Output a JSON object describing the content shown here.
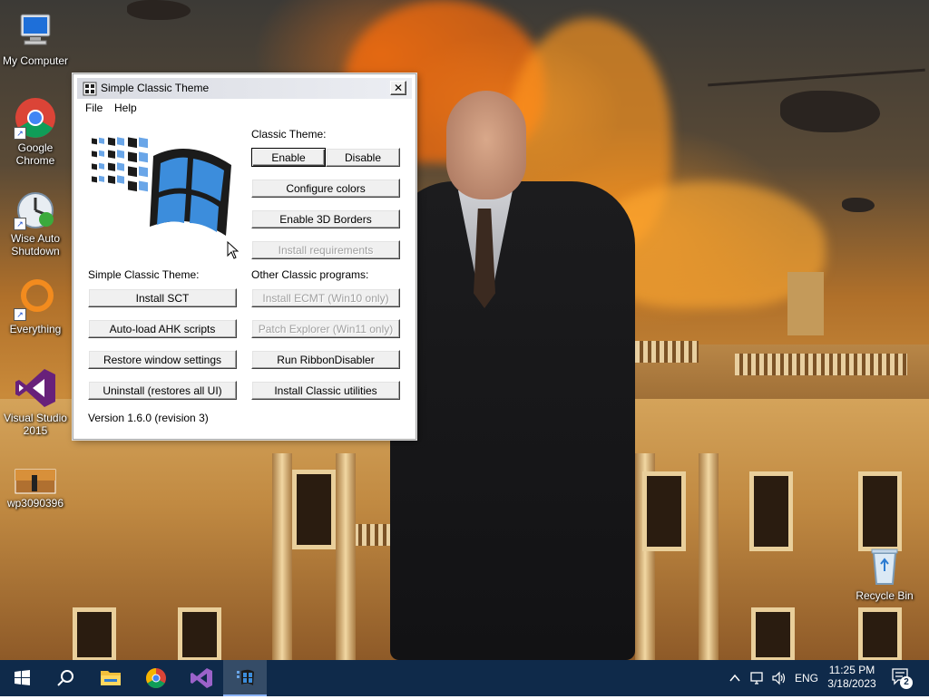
{
  "desktop": {
    "icons": [
      {
        "label": "My Computer",
        "icon": "computer-icon"
      },
      {
        "label": "Google Chrome",
        "icon": "chrome-icon"
      },
      {
        "label": "Wise Auto Shutdown",
        "icon": "wise-auto-shutdown-icon"
      },
      {
        "label": "Everything",
        "icon": "everything-icon"
      },
      {
        "label": "Visual Studio 2015",
        "icon": "visual-studio-icon"
      },
      {
        "label": "wp3090396",
        "icon": "image-file-icon"
      },
      {
        "label": "Recycle Bin",
        "icon": "recycle-bin-icon"
      }
    ]
  },
  "window": {
    "title": "Simple Classic Theme",
    "menu": [
      "File",
      "Help"
    ],
    "classic_theme_label": "Classic Theme:",
    "enable_label": "Enable",
    "disable_label": "Disable",
    "configure_colors_label": "Configure colors",
    "enable_3d_borders_label": "Enable 3D Borders",
    "install_requirements_label": "Install requirements",
    "sct_section_label": "Simple Classic Theme:",
    "install_sct_label": "Install SCT",
    "autoload_ahk_label": "Auto-load AHK scripts",
    "restore_window_label": "Restore window settings",
    "uninstall_label": "Uninstall (restores all UI)",
    "other_programs_label": "Other Classic programs:",
    "install_ecmt_label": "Install ECMT (Win10 only)",
    "patch_explorer_label": "Patch Explorer (Win11 only)",
    "run_ribbon_label": "Run RibbonDisabler",
    "install_utilities_label": "Install Classic utilities",
    "version_text": "Version 1.6.0 (revision 3)"
  },
  "taskbar": {
    "apps": [
      "start",
      "search",
      "file-explorer",
      "chrome",
      "visual-studio",
      "simple-classic-theme"
    ],
    "language": "ENG",
    "time": "11:25 PM",
    "date": "3/18/2023",
    "notification_count": "2"
  },
  "colors": {
    "taskbar": "#0f2a4a",
    "window_face": "#f0f0f0",
    "titlebar": "#d9dbe2"
  }
}
